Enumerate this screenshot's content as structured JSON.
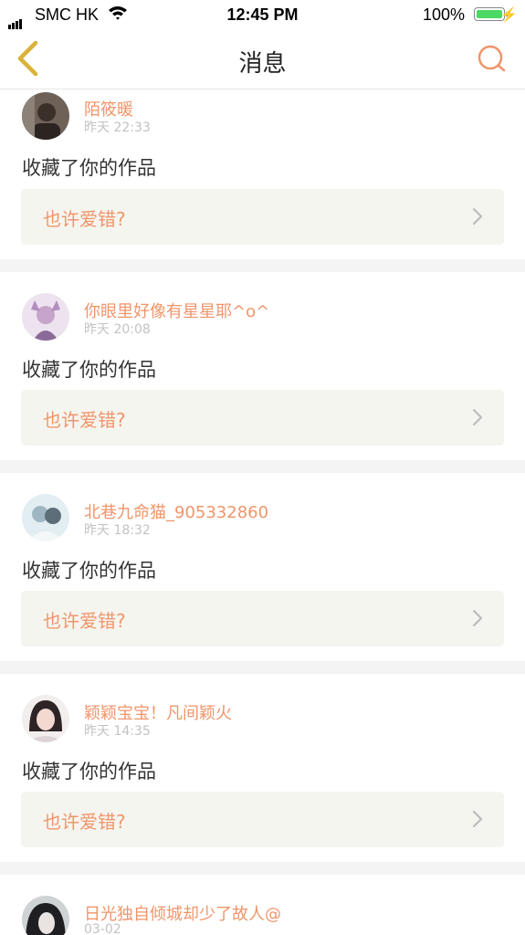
{
  "status_bar": {
    "carrier": "SMC HK",
    "time": "12:45 PM",
    "battery": "100%"
  },
  "nav": {
    "title": "消息"
  },
  "colors": {
    "accent": "#f0956a",
    "back_icon": "#d9b23a",
    "work_box_bg": "#f5f5ef"
  },
  "icons": {
    "back": "chevron-left-icon",
    "search": "search-icon",
    "item_arrow": "chevron-right-icon"
  },
  "messages": [
    {
      "username": "陌筱暖",
      "time": "昨天 22:33",
      "action": "收藏了你的作品",
      "work_title": "也许爱错?"
    },
    {
      "username": "你眼里好像有星星耶^o^",
      "time": "昨天 20:08",
      "action": "收藏了你的作品",
      "work_title": "也许爱错?"
    },
    {
      "username": "北巷九命猫_905332860",
      "time": "昨天 18:32",
      "action": "收藏了你的作品",
      "work_title": "也许爱错?"
    },
    {
      "username": "颖颖宝宝！凡间颖火",
      "time": "昨天 14:35",
      "action": "收藏了你的作品",
      "work_title": "也许爱错?"
    },
    {
      "username": "日光独自倾城却少了故人@",
      "time": "03-02"
    }
  ]
}
